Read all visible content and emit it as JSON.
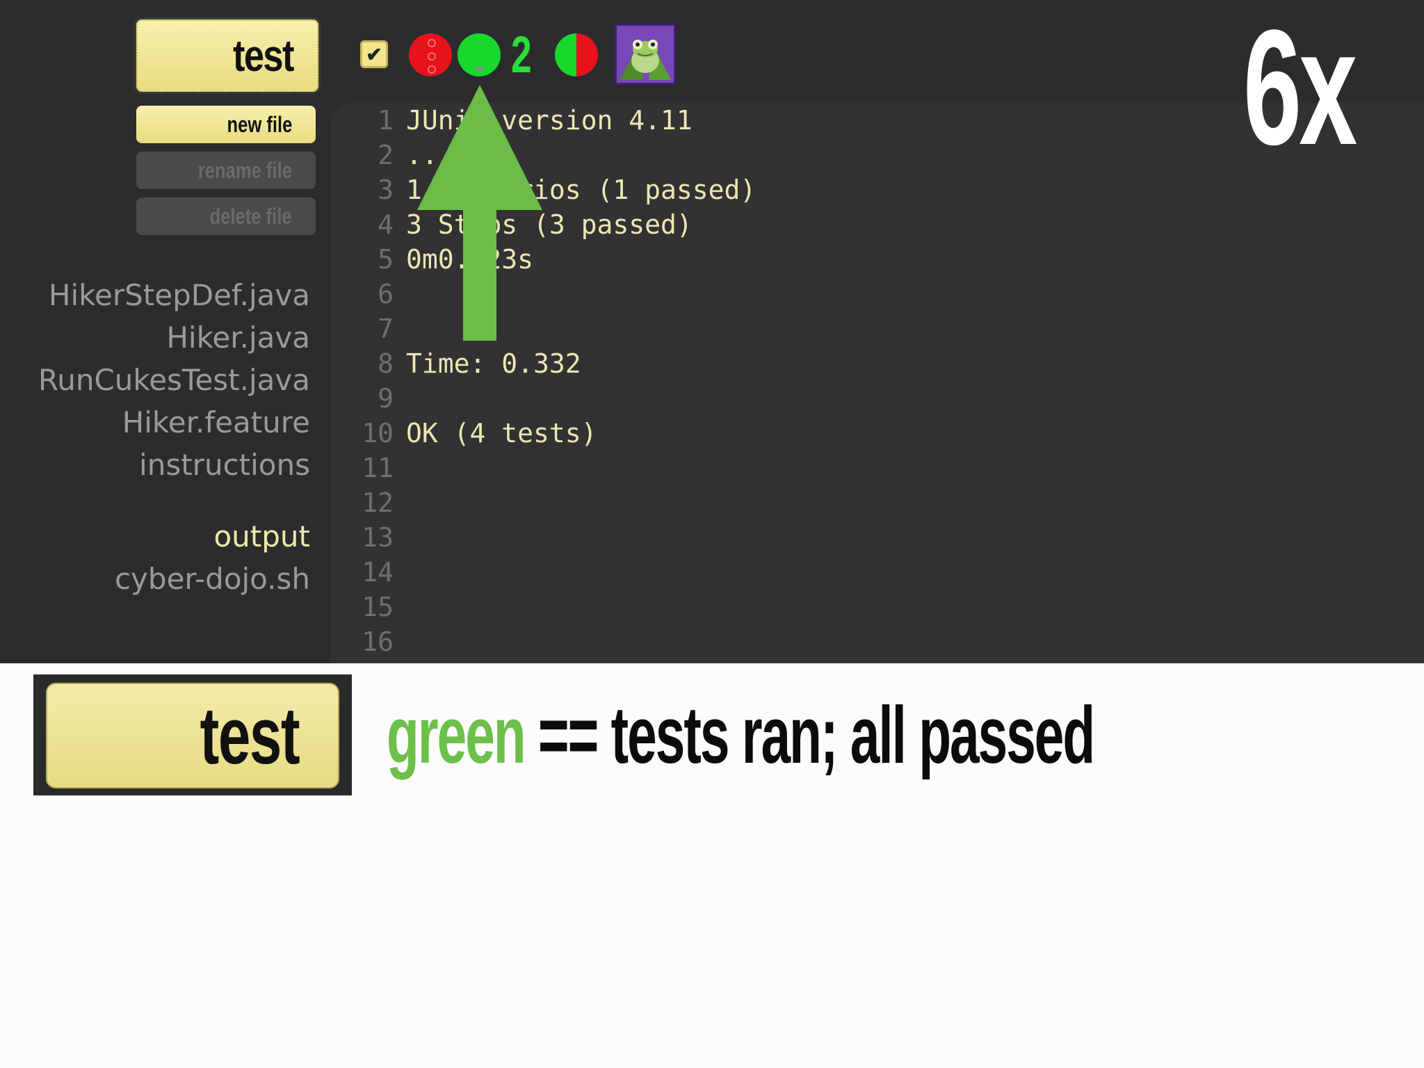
{
  "toolbar": {
    "test_label": "test",
    "new_file_label": "new file",
    "rename_file_label": "rename file",
    "delete_file_label": "delete file"
  },
  "status_bar": {
    "count": "2",
    "colors": {
      "red": "#e8121a",
      "green": "#18d82c"
    },
    "icons": [
      "checkbox-icon",
      "red-light-icon",
      "green-light-icon",
      "ratio-pie-icon",
      "frog-avatar-icon"
    ]
  },
  "files": {
    "items": [
      "HikerStepDef.java",
      "Hiker.java",
      "RunCukesTest.java",
      "Hiker.feature",
      "instructions"
    ],
    "extra": [
      "output",
      "cyber-dojo.sh"
    ],
    "selected": "output"
  },
  "output": {
    "lines": [
      {
        "num": "1",
        "text": "JUnit version 4.11"
      },
      {
        "num": "2",
        "text": ".."
      },
      {
        "num": "3",
        "text": "1 Scenarios (1 passed)"
      },
      {
        "num": "4",
        "text": "3 Steps (3 passed)"
      },
      {
        "num": "5",
        "text": "0m0.123s"
      },
      {
        "num": "6",
        "text": ""
      },
      {
        "num": "7",
        "text": ""
      },
      {
        "num": "8",
        "text": "Time: 0.332"
      },
      {
        "num": "9",
        "text": ""
      },
      {
        "num": "10",
        "text": "OK (4 tests)"
      },
      {
        "num": "11",
        "text": ""
      },
      {
        "num": "12",
        "text": ""
      },
      {
        "num": "13",
        "text": ""
      },
      {
        "num": "14",
        "text": ""
      },
      {
        "num": "15",
        "text": ""
      },
      {
        "num": "16",
        "text": ""
      }
    ]
  },
  "overlay": {
    "multiplier": "6x",
    "arrow_color": "#6cbd45"
  },
  "caption": {
    "button_label": "test",
    "accent_word": "green",
    "rest": " == tests ran; all passed",
    "accent_color": "#6cc04a"
  }
}
